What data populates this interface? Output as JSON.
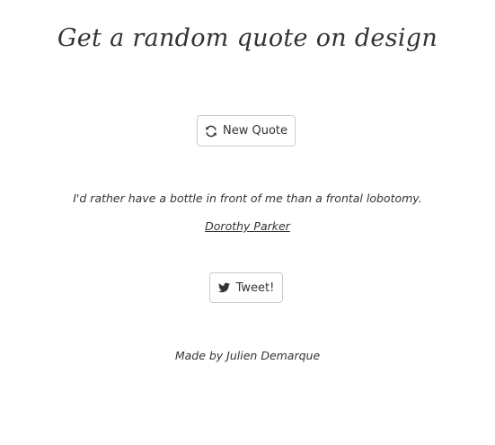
{
  "header": {
    "title": "Get a random quote on design"
  },
  "buttons": {
    "new_quote_label": "New Quote",
    "tweet_label": "Tweet!"
  },
  "quote": {
    "text": "I'd rather have a bottle in front of me than a frontal lobotomy.",
    "author": "Dorothy Parker"
  },
  "footer": {
    "credit": "Made by Julien Demarque"
  },
  "icons": {
    "new_quote": "refresh-icon",
    "tweet": "twitter-icon"
  }
}
